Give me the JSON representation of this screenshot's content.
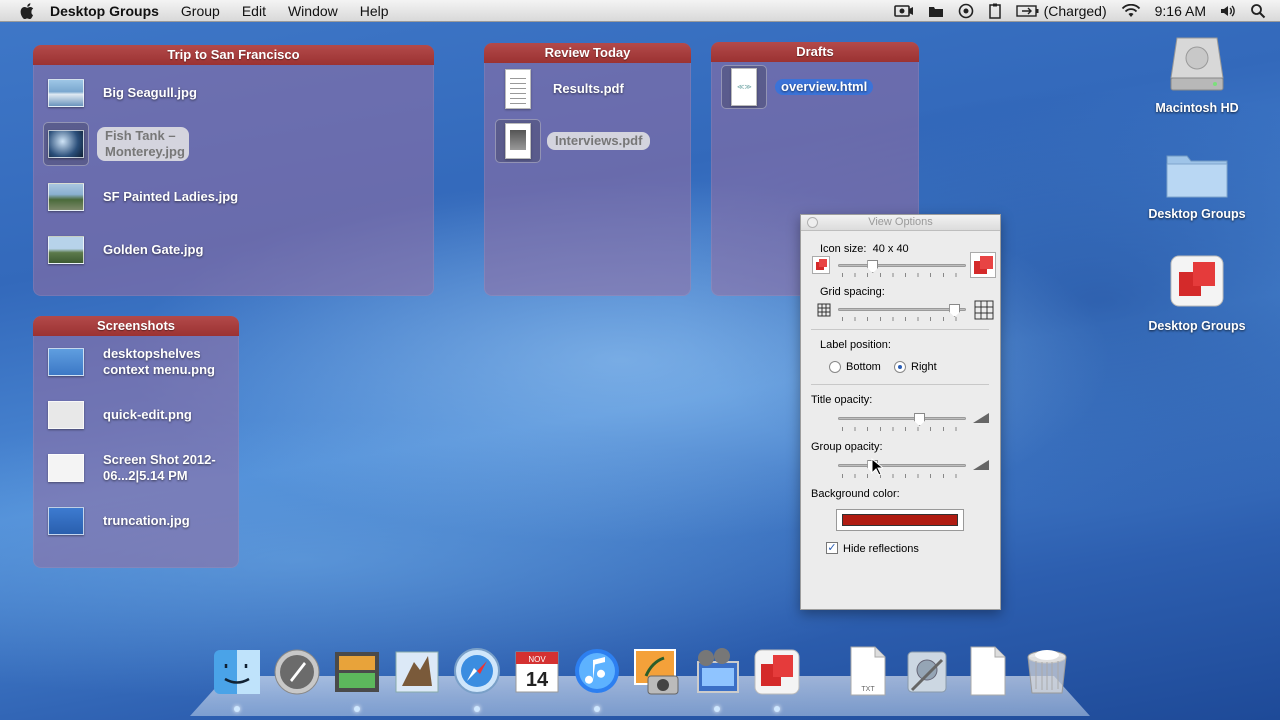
{
  "menubar": {
    "app_name": "Desktop Groups",
    "menus": [
      "Group",
      "Edit",
      "Window",
      "Help"
    ],
    "battery_status": "(Charged)",
    "time": "9:16 AM"
  },
  "shelves": {
    "trip": {
      "title": "Trip to San Francisco",
      "items": [
        "Big Seagull.jpg",
        "Fish Tank – Monterey.jpg",
        "SF Painted Ladies.jpg",
        "Golden Gate.jpg"
      ]
    },
    "review": {
      "title": "Review Today",
      "items": [
        "Results.pdf",
        "Interviews.pdf"
      ]
    },
    "drafts": {
      "title": "Drafts",
      "items": [
        "overview.html"
      ]
    },
    "screenshots": {
      "title": "Screenshots",
      "items": [
        "desktopshelves context menu.png",
        "quick-edit.png",
        "Screen Shot 2012-06...2|5.14 PM",
        "truncation.jpg"
      ]
    }
  },
  "desktop_icons": [
    "Macintosh HD",
    "Desktop Groups",
    "Desktop Groups"
  ],
  "view_options": {
    "title": "View Options",
    "icon_size_label": "Icon size:",
    "icon_size_value": "40 x 40",
    "icon_size_level": 0.25,
    "grid_spacing_label": "Grid spacing:",
    "grid_spacing_level": 0.95,
    "label_position_label": "Label position:",
    "label_position_options": [
      "Bottom",
      "Right"
    ],
    "label_position_selected": "Right",
    "title_opacity_label": "Title opacity:",
    "title_opacity_level": 0.65,
    "group_opacity_label": "Group opacity:",
    "group_opacity_level": 0.25,
    "background_color_label": "Background color:",
    "background_color": "#b01c12",
    "hide_reflections_label": "Hide reflections",
    "hide_reflections_checked": true
  },
  "dock": {
    "items": [
      "finder-icon",
      "launchpad-icon",
      "preview-icon",
      "mail-icon",
      "safari-icon",
      "calendar-icon",
      "itunes-icon",
      "iphoto-icon",
      "imovie-icon",
      "desktop-groups-icon",
      "text-document-icon",
      "system-preferences-icon",
      "blank-document-icon",
      "trash-icon"
    ],
    "calendar_month": "NOV",
    "calendar_day": "14",
    "txt_label": "TXT"
  },
  "colors": {
    "shelf_title": "#a83c3c",
    "shelf_body": "rgba(150,110,160,0.55)",
    "selection_blue": "#3b73d8"
  }
}
